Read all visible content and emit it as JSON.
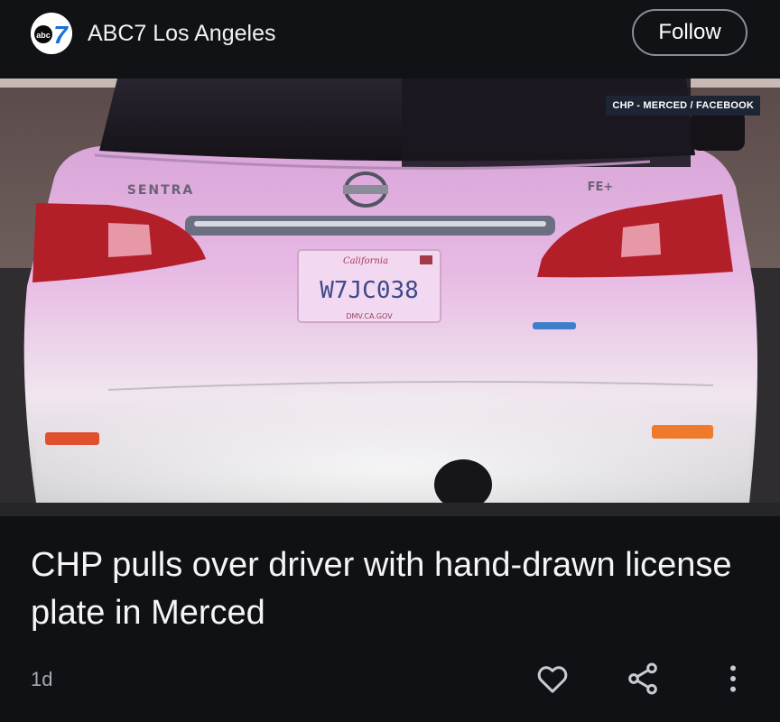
{
  "header": {
    "logo_icon": "abc7-logo",
    "logo_text": "abc",
    "logo_number": "7",
    "source_name": "ABC7 Los Angeles",
    "follow_label": "Follow"
  },
  "photo": {
    "credit": "CHP - MERCED / FACEBOOK",
    "badge_model": "SENTRA",
    "badge_trim": "FE+",
    "plate_state": "California",
    "plate_number": "W7JC038",
    "plate_footer": "DMV.CA.GOV"
  },
  "article": {
    "headline": "CHP pulls over driver with hand-drawn license plate in Merced",
    "age": "1d"
  },
  "actions": {
    "like_icon": "heart-icon",
    "share_icon": "share-icon",
    "more_icon": "more-vertical-icon"
  },
  "colors": {
    "background": "#0f1114",
    "text": "#ffffff",
    "muted": "#a7aab0"
  }
}
